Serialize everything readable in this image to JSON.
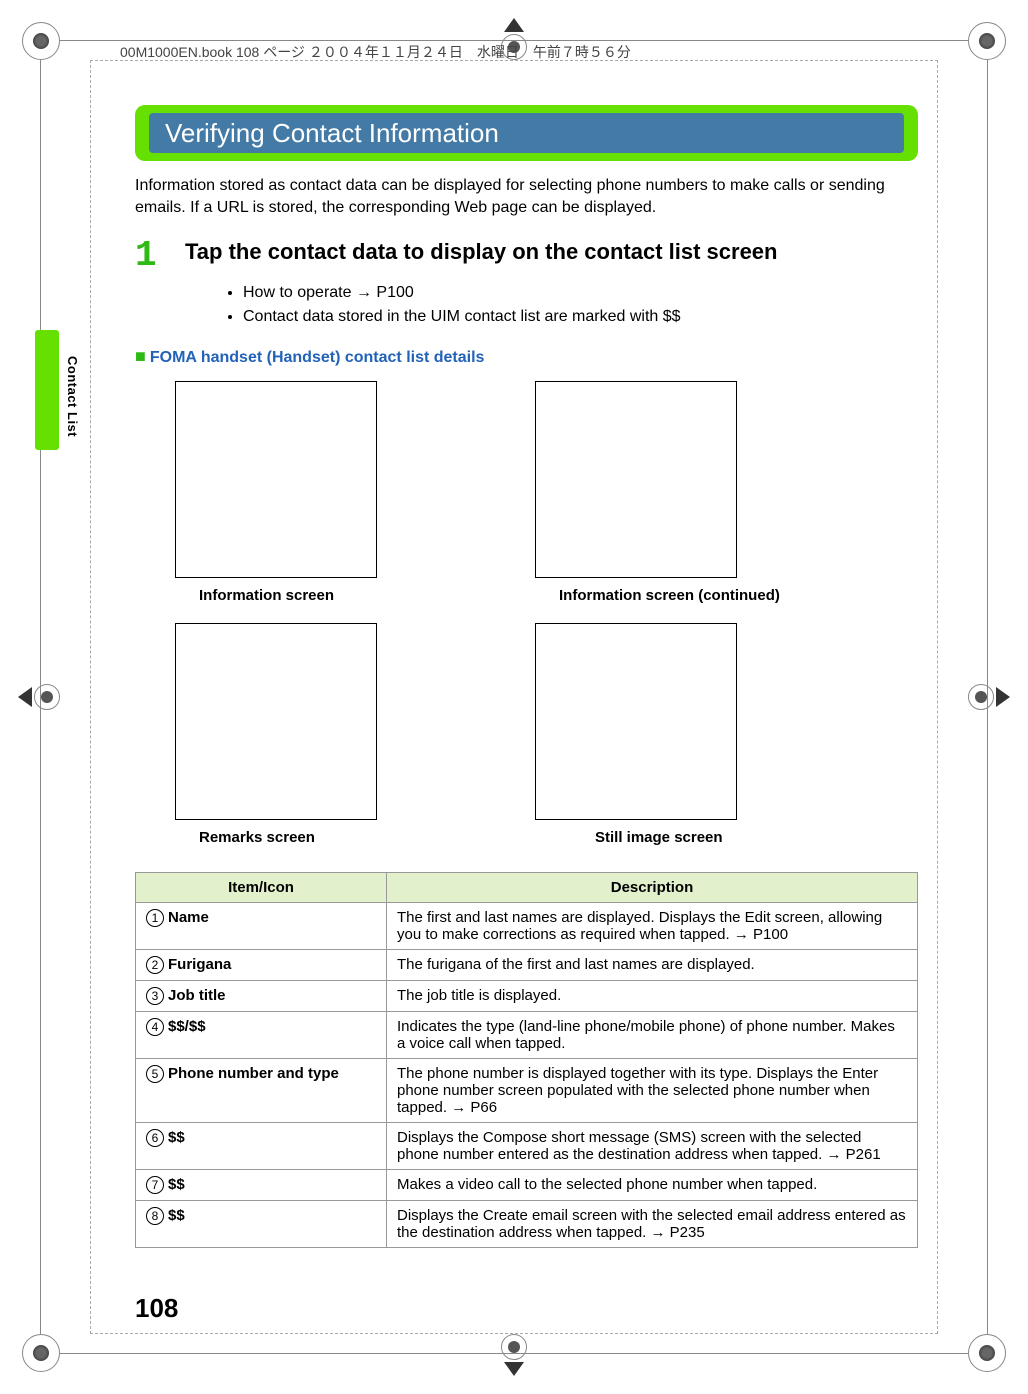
{
  "meta_header": "00M1000EN.book  108 ページ  ２００４年１１月２４日　水曜日　午前７時５６分",
  "side_label": "Contact List",
  "page_number": "108",
  "section_title": "Verifying Contact Information",
  "intro_text": "Information stored as contact data can be displayed for selecting phone numbers to make calls or sending emails. If a URL is stored, the corresponding Web page can be displayed.",
  "step": {
    "number": "1",
    "title": "Tap the contact data to display on the contact list screen",
    "bullets": [
      "How to operate → P100",
      "Contact data stored in the UIM contact list are marked with $$"
    ]
  },
  "subheading": "FOMA handset (Handset) contact list details",
  "captions": {
    "info": "Information screen",
    "info_cont": "Information screen (continued)",
    "remarks": "Remarks screen",
    "still": "Still image screen"
  },
  "table": {
    "header_item": "Item/Icon",
    "header_desc": "Description",
    "rows": [
      {
        "num": "1",
        "item": "Name",
        "desc": "The first and last names are displayed. Displays the Edit screen, allowing you to make corrections as required when tapped. → P100"
      },
      {
        "num": "2",
        "item": "Furigana",
        "desc": "The furigana of the first and last names are displayed."
      },
      {
        "num": "3",
        "item": "Job title",
        "desc": "The job title is displayed."
      },
      {
        "num": "4",
        "item": "$$/$$",
        "desc": "Indicates the type (land-line phone/mobile phone) of phone number. Makes a voice call when tapped."
      },
      {
        "num": "5",
        "item": "Phone number and type",
        "desc": "The phone number is displayed together with its type. Displays the Enter phone number screen populated with the selected phone number when tapped. → P66"
      },
      {
        "num": "6",
        "item": "$$",
        "desc": "Displays the Compose short message (SMS) screen with the selected phone number entered as the destination address when tapped. → P261"
      },
      {
        "num": "7",
        "item": "$$",
        "desc": "Makes a video call to the selected phone number when tapped."
      },
      {
        "num": "8",
        "item": "$$",
        "desc": "Displays the Create email screen with the selected email address entered as the destination address when tapped. → P235"
      }
    ]
  }
}
